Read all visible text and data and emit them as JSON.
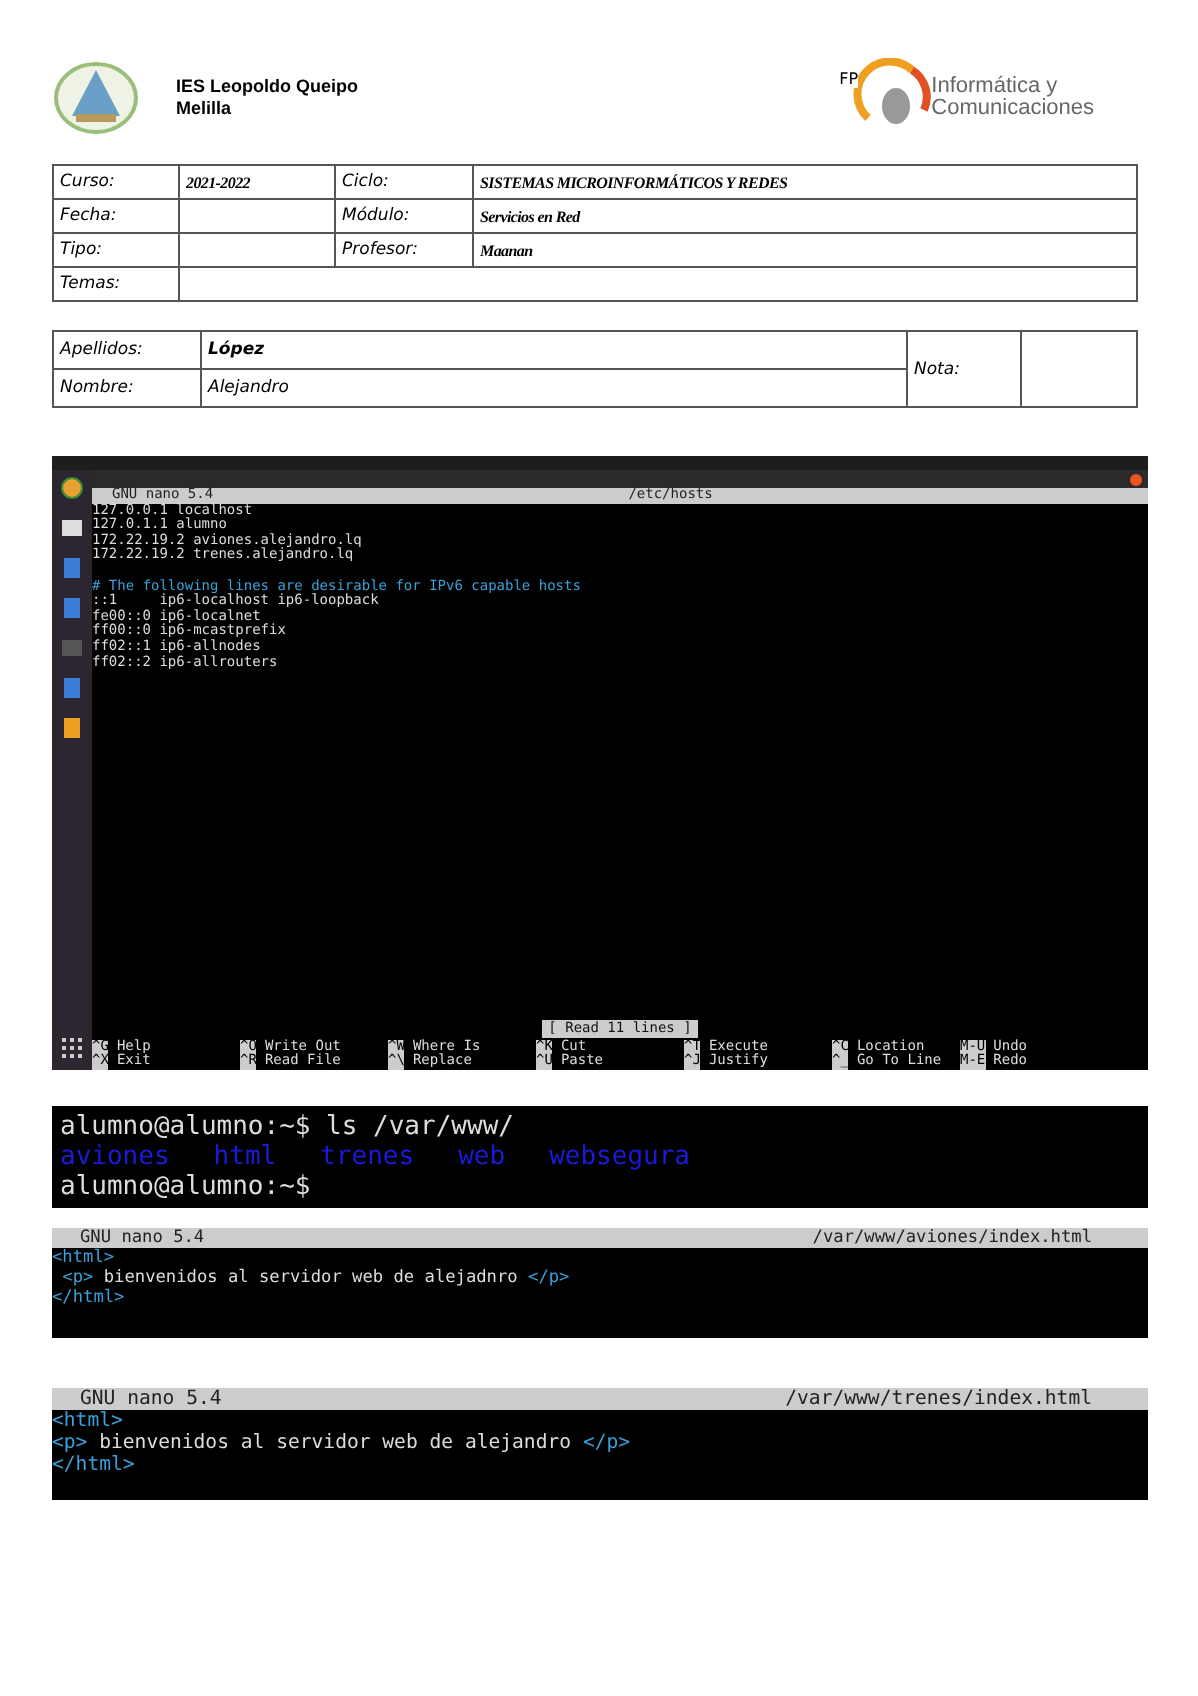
{
  "header": {
    "school": [
      "IES Leopoldo Queipo",
      "Melilla"
    ],
    "logo_badge": "FP",
    "logo_text": [
      "Informática y",
      "Comunicaciones"
    ]
  },
  "info_table": {
    "rows": [
      {
        "label": "Curso:",
        "value": "2021-2022",
        "label2": "Ciclo:",
        "value2": "SISTEMAS MICROINFORMÁTICOS Y REDES"
      },
      {
        "label": "Fecha:",
        "value": "",
        "label2": "Módulo:",
        "value2": "Servicios en Red"
      },
      {
        "label": "Tipo:",
        "value": "",
        "label2": "Profesor:",
        "value2": "Maanan"
      }
    ],
    "temas_label": "Temas:"
  },
  "student": {
    "surname_label": "Apellidos:",
    "surname": "López",
    "name_label": "Nombre:",
    "name": "Alejandro",
    "grade_label": "Nota:"
  },
  "desktop": {
    "editor": {
      "title": "GNU nano 5.4",
      "file": "/etc/hosts",
      "lines": [
        {
          "kind": "plain",
          "text": "127.0.0.1 localhost"
        },
        {
          "kind": "plain",
          "text": "127.0.1.1 alumno"
        },
        {
          "kind": "plain",
          "text": "172.22.19.2 aviones.alejandro.lq"
        },
        {
          "kind": "plain",
          "text": "172.22.19.2 trenes.alejandro.lq"
        },
        {
          "kind": "blank"
        },
        {
          "kind": "comment",
          "text": "# The following lines are desirable for IPv6 capable hosts"
        },
        {
          "kind": "plain",
          "text": "::1     ip6-localhost ip6-loopback"
        },
        {
          "kind": "plain",
          "text": "fe00::0 ip6-localnet"
        },
        {
          "kind": "plain",
          "text": "ff00::0 ip6-mcastprefix"
        },
        {
          "kind": "plain",
          "text": "ff02::1 ip6-allnodes"
        },
        {
          "kind": "plain",
          "text": "ff02::2 ip6-allrouters"
        }
      ],
      "status": "[ Read 11 lines ]",
      "shortcuts": [
        [
          {
            "key": "^G",
            "label": "Help"
          },
          {
            "key": "^O",
            "label": "Write Out"
          },
          {
            "key": "^W",
            "label": "Where Is"
          },
          {
            "key": "^K",
            "label": "Cut"
          },
          {
            "key": "^T",
            "label": "Execute"
          },
          {
            "key": "^C",
            "label": "Location"
          },
          {
            "key": "M-U",
            "label": "Undo"
          }
        ],
        [
          {
            "key": "^X",
            "label": "Exit"
          },
          {
            "key": "^R",
            "label": "Read File"
          },
          {
            "key": "^\\",
            "label": "Replace"
          },
          {
            "key": "^U",
            "label": "Paste"
          },
          {
            "key": "^J",
            "label": "Justify"
          },
          {
            "key": "^_",
            "label": "Go To Line"
          },
          {
            "key": "M-E",
            "label": "Redo"
          }
        ]
      ]
    }
  },
  "terminal": {
    "lines": [
      {
        "kind": "prompt",
        "text": "alumno@alumno:~$ ls /var/www/"
      },
      {
        "kind": "dirs",
        "items": [
          "aviones",
          "html",
          "trenes",
          "web",
          "websegura"
        ]
      },
      {
        "kind": "prompt",
        "text": "alumno@alumno:~$"
      }
    ]
  },
  "editors": [
    {
      "title": "GNU nano 5.4",
      "file": "/var/www/aviones/index.html",
      "lines": [
        [
          {
            "kind": "tag",
            "text": "<html>"
          }
        ],
        [
          {
            "kind": "tag",
            "text": " <p>"
          },
          {
            "kind": "text",
            "text": " bienvenidos al servidor web de alejadnro "
          },
          {
            "kind": "tag",
            "text": "</p>"
          }
        ],
        [
          {
            "kind": "tag",
            "text": "</html>"
          }
        ]
      ]
    },
    {
      "title": "GNU nano 5.4",
      "file": "/var/www/trenes/index.html",
      "lines": [
        [
          {
            "kind": "tag",
            "text": "<html>"
          }
        ],
        [
          {
            "kind": "tag",
            "text": "<p>"
          },
          {
            "kind": "text",
            "text": " bienvenidos al servidor web de alejandro "
          },
          {
            "kind": "tag",
            "text": "</p>"
          }
        ],
        [
          {
            "kind": "tag",
            "text": "</html>"
          }
        ]
      ]
    }
  ]
}
